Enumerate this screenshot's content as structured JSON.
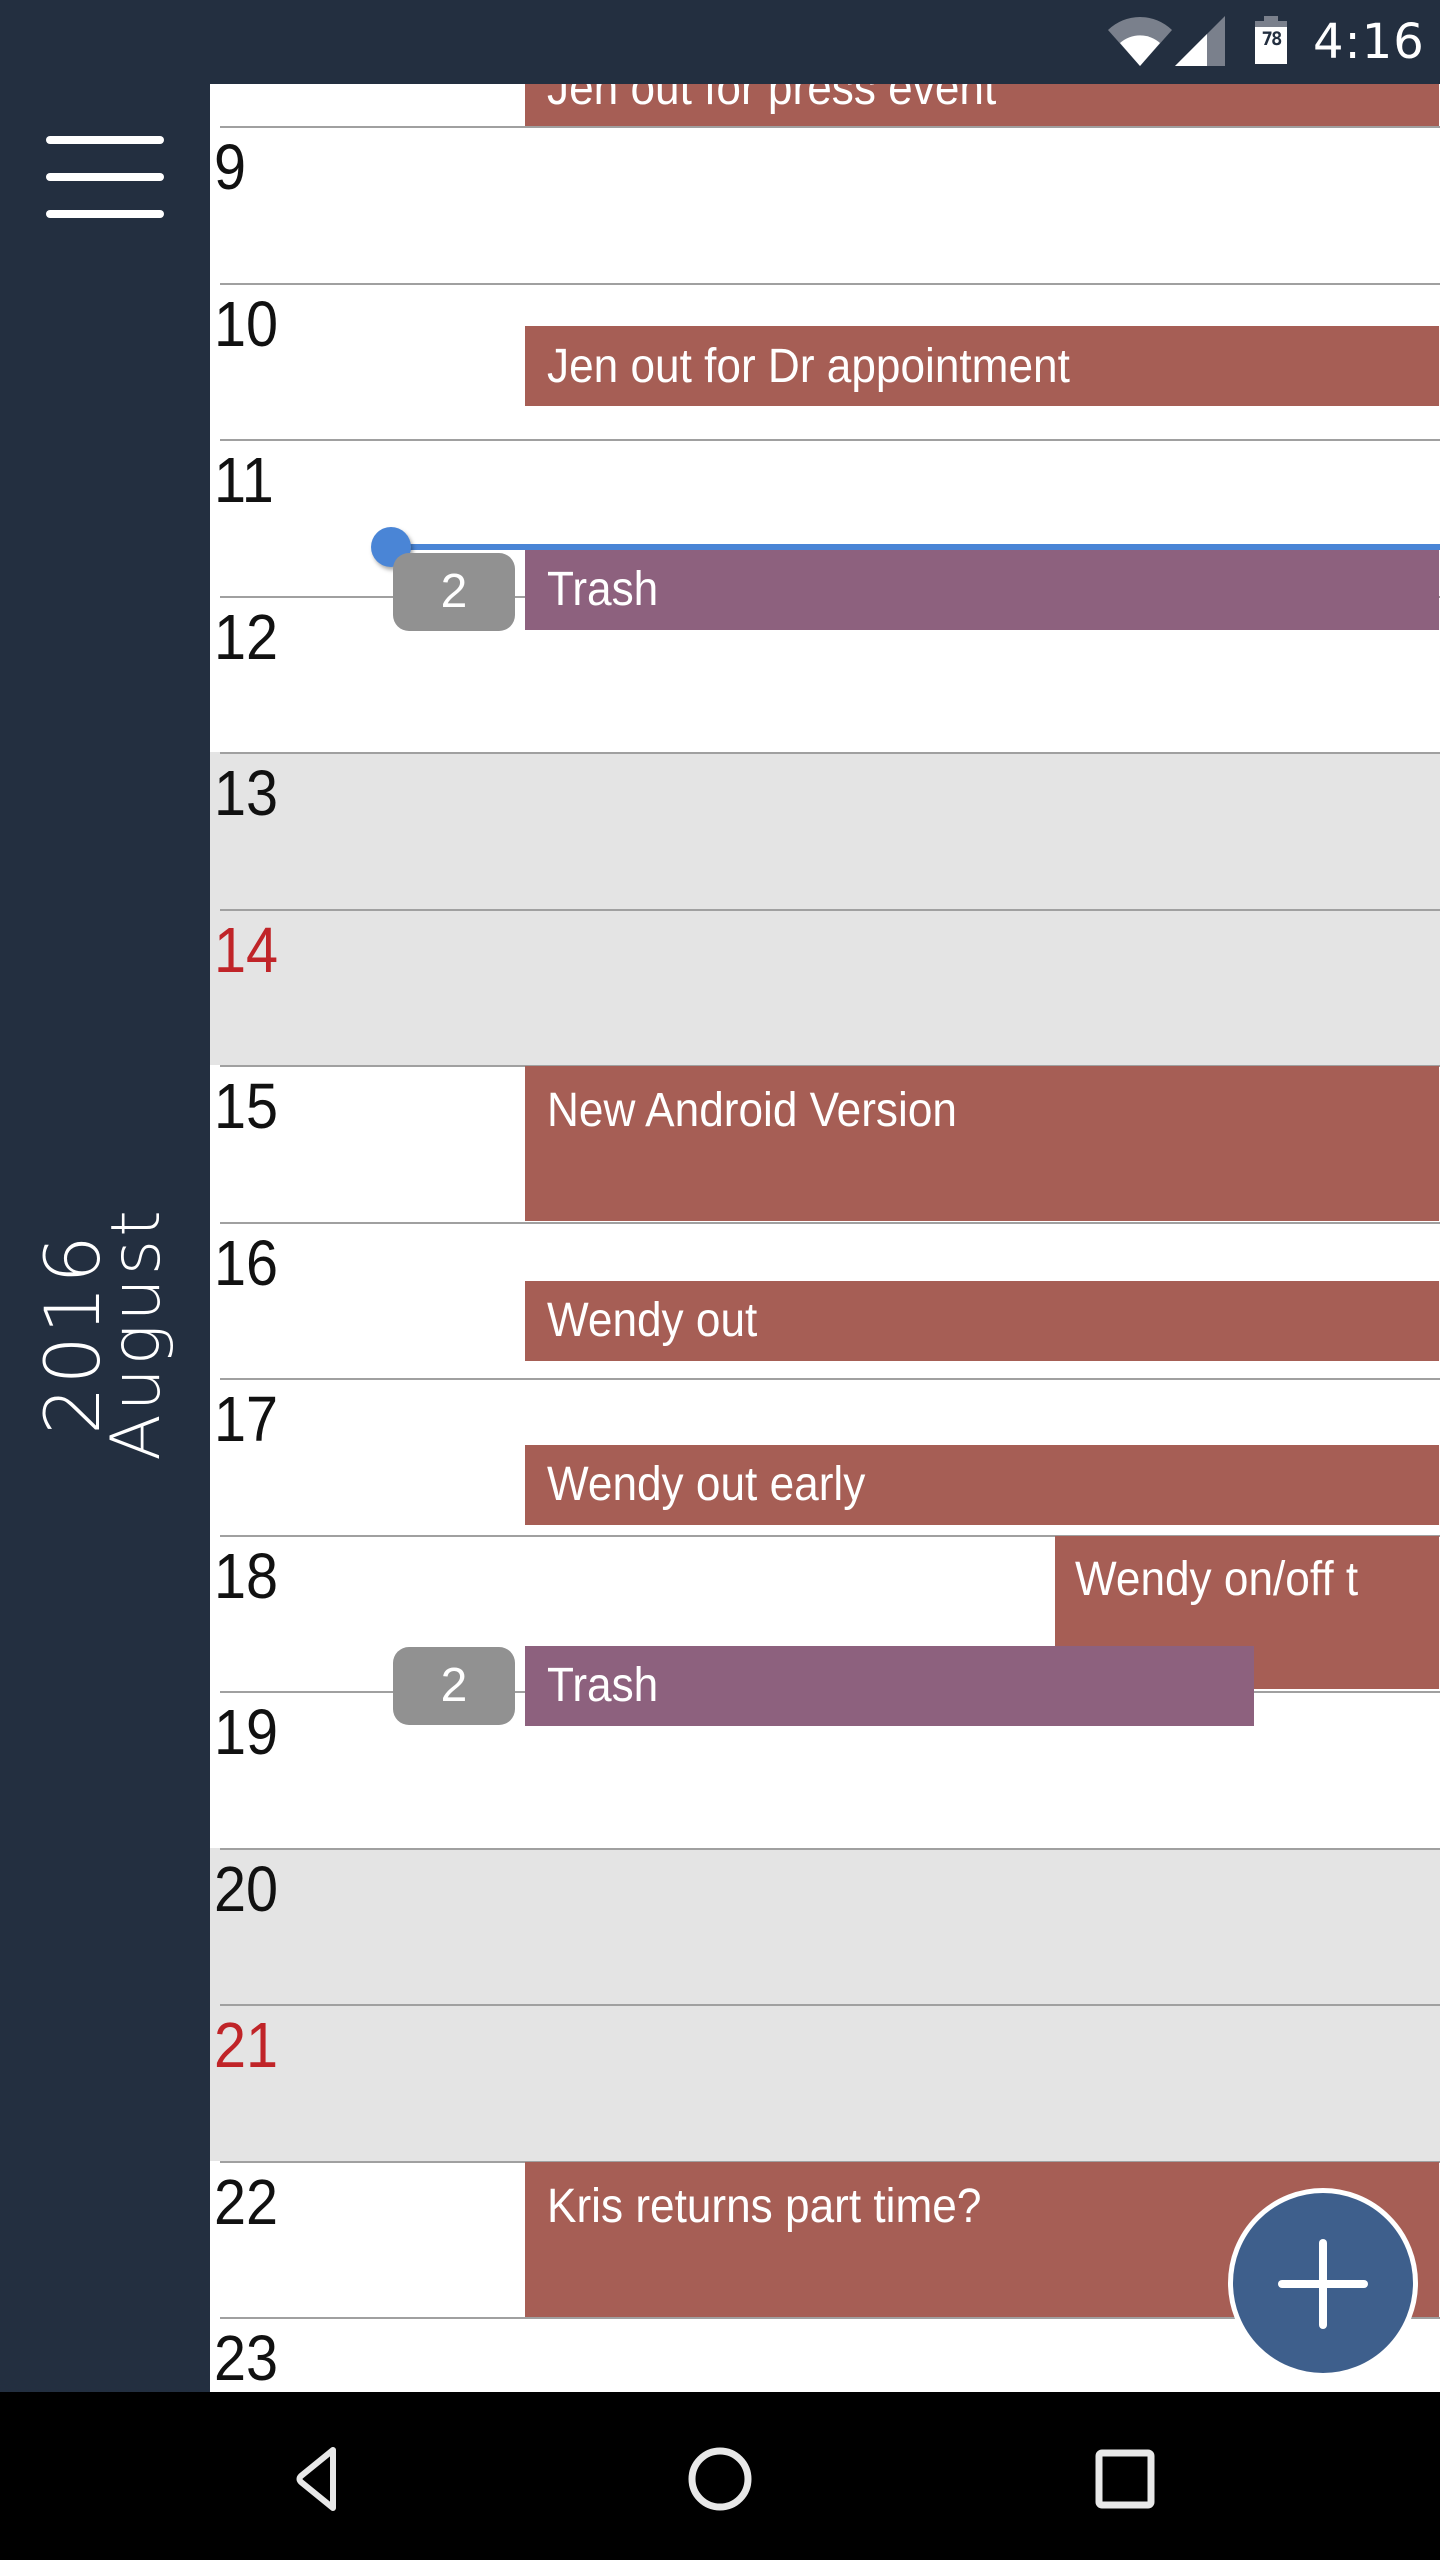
{
  "status_bar": {
    "time": "4:16",
    "battery_level": "78",
    "icons": [
      "wifi-icon",
      "cell-signal-icon",
      "battery-icon"
    ]
  },
  "sidebar": {
    "menu_icon": "hamburger-menu-icon",
    "year": "2016",
    "month": "August"
  },
  "calendar": {
    "days": [
      {
        "day": "9",
        "weekend": false,
        "sunday": false
      },
      {
        "day": "10",
        "weekend": false,
        "sunday": false
      },
      {
        "day": "11",
        "weekend": false,
        "sunday": false
      },
      {
        "day": "12",
        "weekend": false,
        "sunday": false
      },
      {
        "day": "13",
        "weekend": true,
        "sunday": false
      },
      {
        "day": "14",
        "weekend": true,
        "sunday": true
      },
      {
        "day": "15",
        "weekend": false,
        "sunday": false
      },
      {
        "day": "16",
        "weekend": false,
        "sunday": false
      },
      {
        "day": "17",
        "weekend": false,
        "sunday": false
      },
      {
        "day": "18",
        "weekend": false,
        "sunday": false
      },
      {
        "day": "19",
        "weekend": false,
        "sunday": false
      },
      {
        "day": "20",
        "weekend": true,
        "sunday": false
      },
      {
        "day": "21",
        "weekend": true,
        "sunday": true
      },
      {
        "day": "22",
        "weekend": false,
        "sunday": false
      },
      {
        "day": "23",
        "weekend": false,
        "sunday": false
      }
    ],
    "events": [
      {
        "title": "Jen out for press event",
        "day": "8",
        "color": "#a65e55"
      },
      {
        "title": "Jen out for Dr appointment",
        "day": "10",
        "color": "#a65e55"
      },
      {
        "title": "Trash",
        "day": "11",
        "color": "#8d617e",
        "count": "2"
      },
      {
        "title": "New Android Version",
        "day": "15",
        "color": "#a65e55"
      },
      {
        "title": "Wendy out",
        "day": "16",
        "color": "#a65e55"
      },
      {
        "title": "Wendy out early",
        "day": "17",
        "color": "#a65e55"
      },
      {
        "title": "Wendy on/off t",
        "day": "18",
        "color": "#a65e55"
      },
      {
        "title": "Trash",
        "day": "18",
        "color": "#8d617e",
        "count": "2"
      },
      {
        "title": "Kris returns part time?",
        "day": "22",
        "color": "#a65e55"
      }
    ],
    "current_time_indicator": {
      "color": "#4a85d6"
    },
    "sunday_color": "#c02428",
    "weekend_bg": "#e4e4e4"
  },
  "fab": {
    "icon": "plus-icon",
    "label": "Add event",
    "color": "#3e5f8c"
  },
  "nav_bar": {
    "buttons": [
      "back-icon",
      "home-icon",
      "recents-icon"
    ]
  }
}
